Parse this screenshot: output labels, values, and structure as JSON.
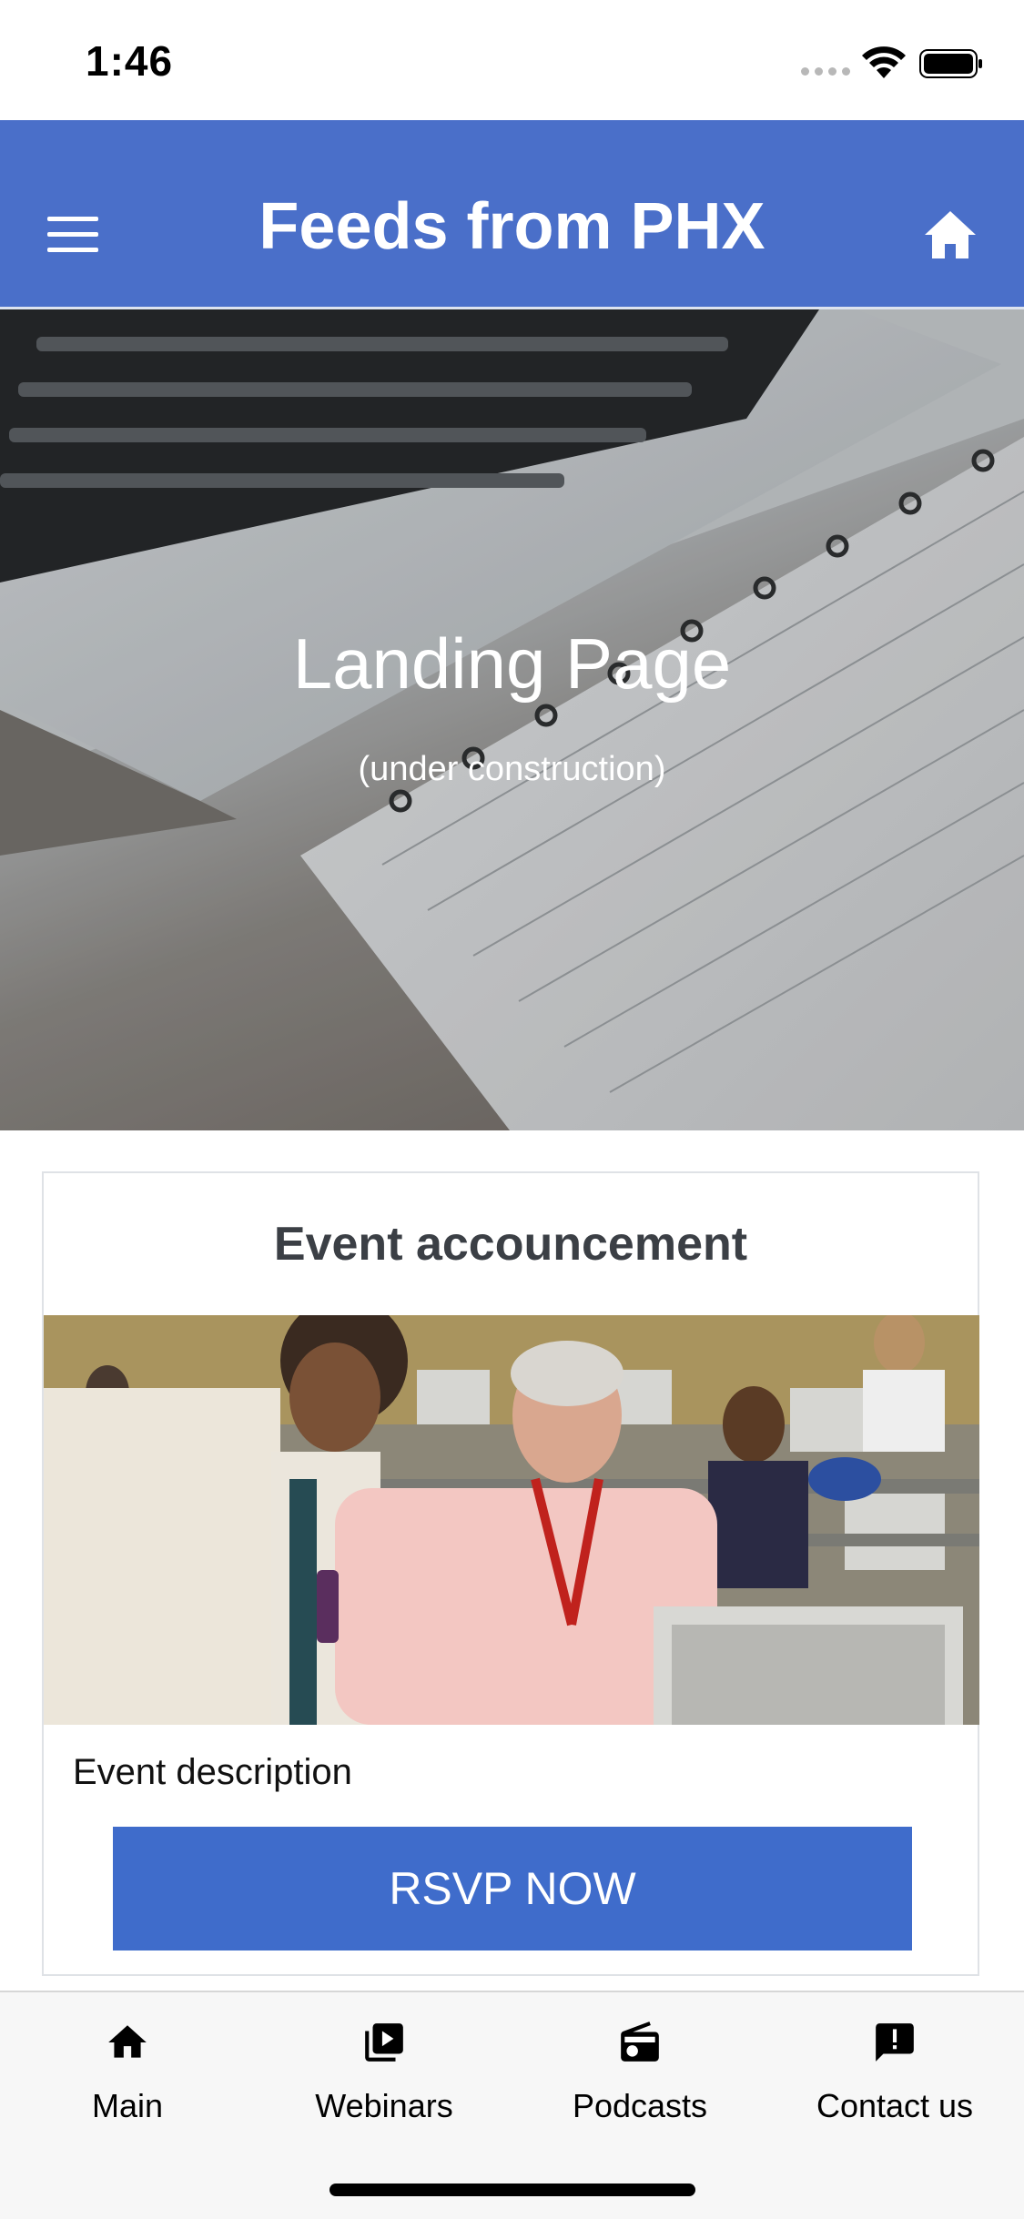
{
  "status_bar": {
    "time": "1:46"
  },
  "nav": {
    "title": "Feeds from PHX"
  },
  "hero": {
    "title": "Landing Page",
    "subtitle": "(under construction)"
  },
  "event": {
    "title": "Event accouncement",
    "description": "Event description",
    "rsvp_label": "RSVP NOW"
  },
  "tabs": [
    {
      "label": "Main",
      "icon": "home-icon"
    },
    {
      "label": "Webinars",
      "icon": "video-library-icon"
    },
    {
      "label": "Podcasts",
      "icon": "radio-icon"
    },
    {
      "label": "Contact us",
      "icon": "feedback-icon"
    }
  ],
  "colors": {
    "primary": "#4a6fc9",
    "button": "#3f6ccb",
    "tab_bar": "#f7f7f7"
  }
}
